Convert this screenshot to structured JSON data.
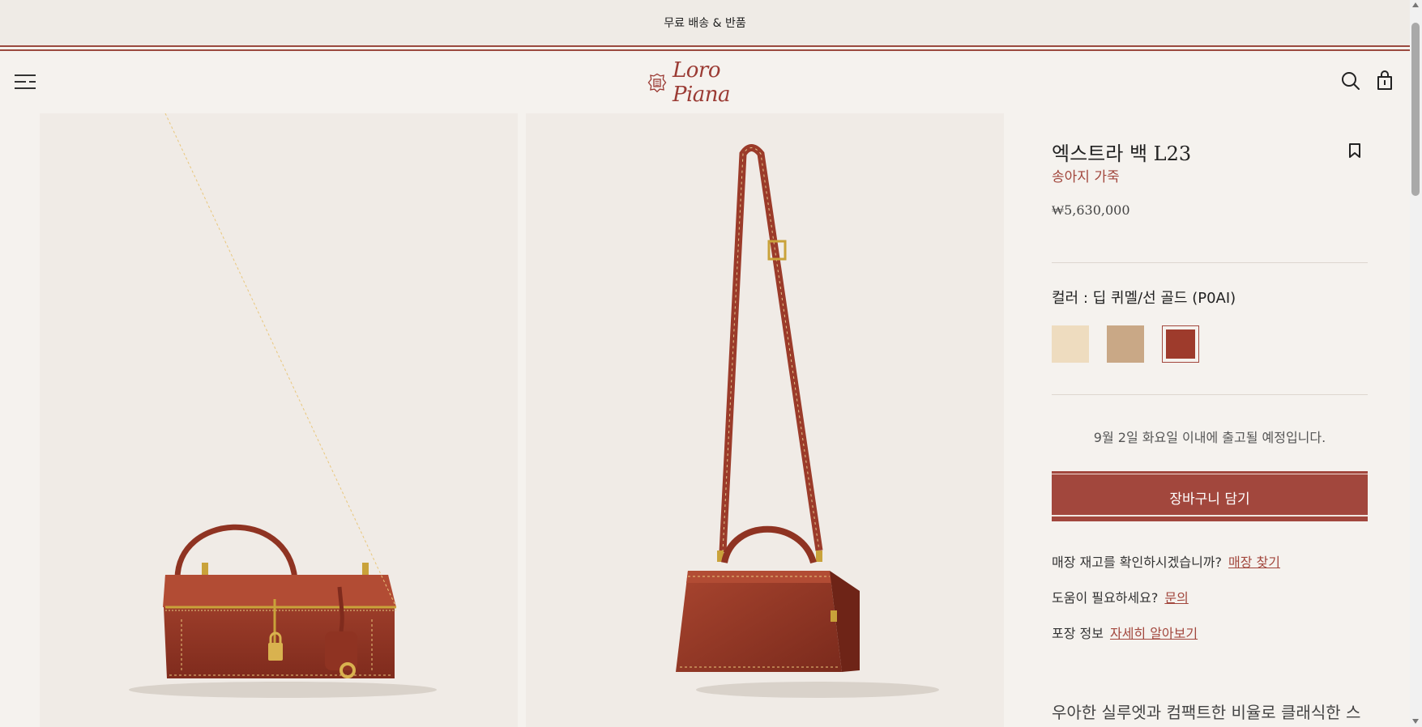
{
  "announcement": "무료 배송 & 반품",
  "brand": {
    "logo_text": "Loro Piana"
  },
  "product": {
    "title": "엑스트라 백 L23",
    "family": "송아지 가죽",
    "price": "₩5,630,000",
    "color_label": "컬러 : 딥 퀴멜/선 골드 (P0AI)",
    "swatches": [
      {
        "name": "cream",
        "color": "#eedcbf"
      },
      {
        "name": "beige",
        "color": "#c9a886"
      },
      {
        "name": "deep-red-brown",
        "color": "#9e3b2c",
        "selected": true
      }
    ],
    "delivery": "9월 2일 화요일 이내에 출고될 예정입니다.",
    "add_to_cart": "장바구니 담기",
    "store_stock": {
      "text": "매장 재고를 확인하시겠습니까?",
      "link": "매장 찾기"
    },
    "help": {
      "text": "도움이 필요하세요?",
      "link": "문의"
    },
    "packaging": {
      "text": "포장 정보",
      "link": "자세히 알아보기"
    },
    "description": "우아한 실루엣과 컴팩트한 비율로 클래식한 스"
  },
  "colors": {
    "accent": "#a2473d",
    "background": "#f5f2ee",
    "photo_bg": "#f0ebe6"
  },
  "icons": [
    "menu-icon",
    "search-icon",
    "shopping-bag-icon",
    "bookmark-icon"
  ]
}
